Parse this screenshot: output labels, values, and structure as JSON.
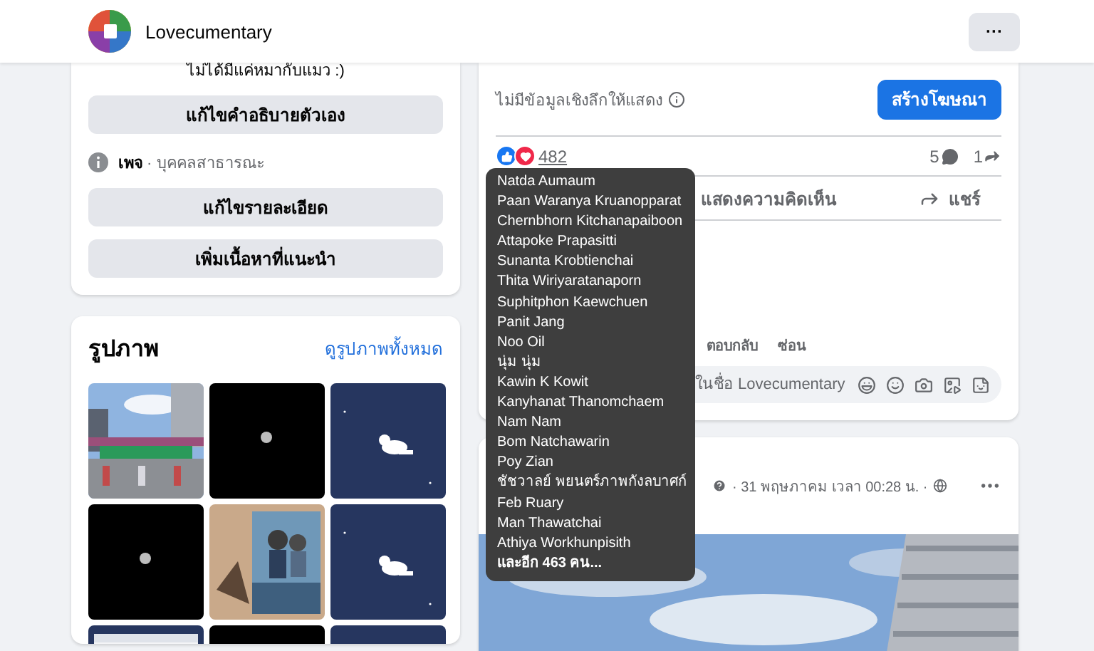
{
  "header": {
    "page_name": "Lovecumentary",
    "more_label": "···"
  },
  "about_card": {
    "bio": "ไม่ได้มีแค่หมากับแมว :)",
    "edit_bio_button": "แก้ไขคำอธิบายตัวเอง",
    "page_category": "**เพจ** · บุคคลสาธารณะ",
    "buttons": [
      "แก้ไขรายละเอียด",
      "เพิ่มเนื้อหาที่แนะนำ"
    ]
  },
  "photos_card": {
    "title": "รูปภาพ",
    "see_all_link": "ดูรูปภาพทั้งหมด"
  },
  "post": {
    "insights_text": "ไม่มีข้อมูลเชิงลึกให้แสดง",
    "boost_button": "สร้างโฆษณา",
    "reaction_count": "482",
    "comment_count": "5",
    "share_count": "1",
    "actions": [
      "แสดงความคิดเห็น",
      "แชร์"
    ],
    "comment_actions": [
      "ตอบกลับ",
      "ซ่อน"
    ],
    "comment_placeholder": "ในชื่อ Lovecumentary"
  },
  "next_post": {
    "meta": "· 31 พฤษภาคม เวลา 00:28 น. ·"
  },
  "reactions_tooltip": {
    "names": [
      "Natda Aumaum",
      "Paan Waranya Kruanopparat",
      "Chernbhorn Kitchanapaiboon",
      "Attapoke Prapasitti",
      "Sunanta Krobtienchai",
      "Thita Wiriyaratanaporn",
      "Suphitphon Kaewchuen",
      "Panit Jang",
      "Noo Oil",
      "นุ่ม นุ่ม",
      "Kawin K Kowit",
      "Kanyhanat Thanomchaem",
      "Nam Nam",
      "Bom Natchawarin",
      "Poy Zian",
      "ชัชวาลย์ พยนตร์ภาพกังลบาศก์",
      "Feb Ruary",
      "Man Thawatchai",
      "Athiya Workhunpisith"
    ],
    "more_text": "และอีก 463 คน..."
  }
}
